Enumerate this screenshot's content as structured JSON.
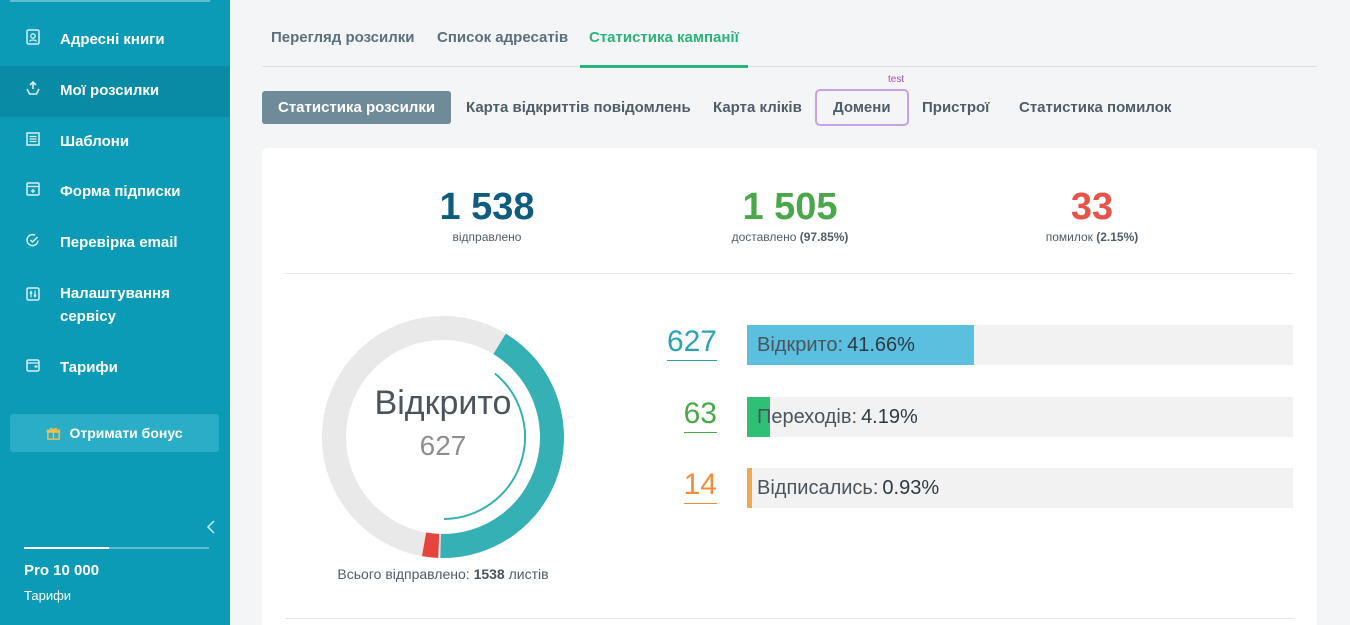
{
  "sidebar": {
    "items": [
      {
        "label": "Адресні книги",
        "icon": "address-book-icon"
      },
      {
        "label": "Мої розсилки",
        "icon": "send-icon"
      },
      {
        "label": "Шаблони",
        "icon": "template-icon"
      },
      {
        "label": "Форма підписки",
        "icon": "form-icon"
      },
      {
        "label": "Перевірка email",
        "icon": "check-icon"
      },
      {
        "label": "Налаштування сервісу",
        "icon": "sliders-icon"
      },
      {
        "label": "Тарифи",
        "icon": "wallet-icon"
      }
    ],
    "active_index": 1,
    "bonus_label": "Отримати бонус",
    "plan_name": "Pro 10 000",
    "plan_link": "Тарифи",
    "plan_usage_fraction": 0.46
  },
  "tabs": [
    {
      "label": "Перегляд розсилки"
    },
    {
      "label": "Список адресатів"
    },
    {
      "label": "Статистика кампанії"
    }
  ],
  "subtabs": [
    {
      "label": "Статистика розсилки"
    },
    {
      "label": "Карта відкриттів повідомлень"
    },
    {
      "label": "Карта кліків"
    },
    {
      "label": "Домени"
    },
    {
      "label": "Пристрої"
    },
    {
      "label": "Статистика помилок"
    }
  ],
  "test_label": "test",
  "summary": {
    "sent": {
      "value": "1 538",
      "label": "відправлено"
    },
    "delivered": {
      "value": "1 505",
      "label": "доставлено",
      "pct": "(97.85%)"
    },
    "errors": {
      "value": "33",
      "label": "помилок",
      "pct": "(2.15%)"
    }
  },
  "donut": {
    "label": "Відкрито",
    "value": "627",
    "opened_fraction": 0.4166,
    "error_fraction": 0.0215
  },
  "total": {
    "prefix": "Всього відправлено:",
    "count": "1538",
    "suffix": "листів"
  },
  "bars": [
    {
      "count": "627",
      "label": "Відкрито:",
      "pct_text": "41.66%",
      "fraction": 0.4166,
      "color": "#5bbfe0",
      "count_color": "#2aa3b3"
    },
    {
      "count": "63",
      "label": "Переходів:",
      "pct_text": "4.19%",
      "fraction": 0.0419,
      "color": "#2ec176",
      "count_color": "#4aa84a"
    },
    {
      "count": "14",
      "label": "Відписались:",
      "pct_text": "0.93%",
      "fraction": 0.0093,
      "color": "#f0a84c",
      "count_color": "#ee8d3a"
    }
  ],
  "colors": {
    "sidebar_bg": "#0b9bb7",
    "accent_green": "#2ab37a",
    "sent_color": "#0f5d7e",
    "delivered_color": "#4aa84a",
    "error_color": "#e5534b",
    "donut_open": "#35b0b5",
    "donut_error": "#e5453c",
    "donut_rest": "#e9e9e9"
  }
}
